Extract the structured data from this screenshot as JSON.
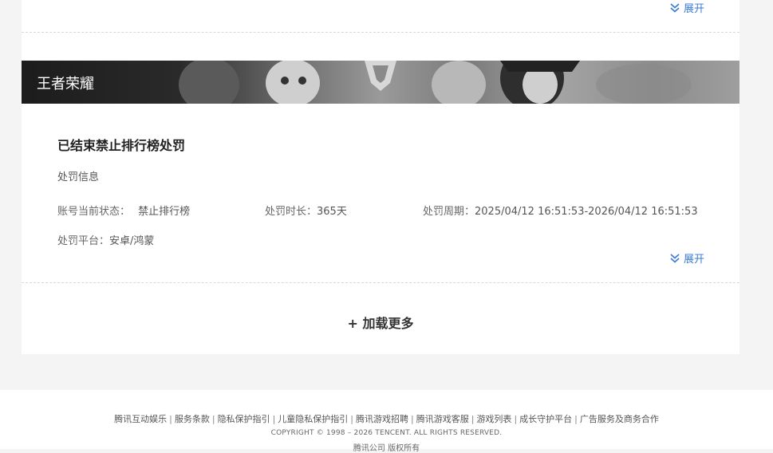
{
  "top_record": {
    "expand_label": "展开"
  },
  "game": {
    "name": "王者荣耀"
  },
  "record": {
    "title": "已结束禁止排行榜处罚",
    "section": "处罚信息",
    "status_label": "账号当前状态：",
    "status_value": "禁止排行榜",
    "duration_label": "处罚时长：",
    "duration_value": "365天",
    "period_label": "处罚周期：",
    "period_value": "2025/04/12 16:51:53-2026/04/12 16:51:53",
    "platform_label": "处罚平台：",
    "platform_value": "安卓/鸿蒙",
    "expand_label": "展开"
  },
  "load_more": {
    "label": "+ 加载更多"
  },
  "footer": {
    "links": [
      "腾讯互动娱乐",
      "服务条款",
      "隐私保护指引",
      "儿童隐私保护指引",
      "腾讯游戏招聘",
      "腾讯游戏客服",
      "游戏列表",
      "成长守护平台",
      "广告服务及商务合作"
    ],
    "copyright": "COPYRIGHT © 1998 – 2026 TENCENT. ALL RIGHTS RESERVED.",
    "company": "腾讯公司 版权所有"
  },
  "colors": {
    "accent": "#3a7bd5",
    "page_bg": "#f4f4f4",
    "card_bg": "#ffffff"
  },
  "icons": {
    "expand": "double-chevron-down-icon"
  }
}
